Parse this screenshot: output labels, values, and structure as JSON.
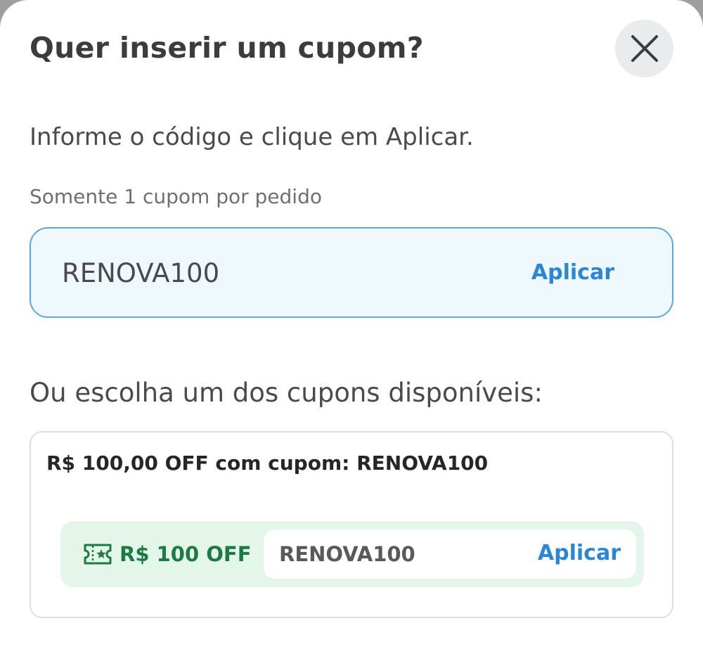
{
  "modal": {
    "title": "Quer inserir um cupom?",
    "close_icon": "close-icon",
    "instruction": "Informe o código e clique em Aplicar.",
    "hint": "Somente 1 cupom por pedido",
    "code_input": {
      "value": "RENOVA100",
      "apply_label": "Aplicar"
    },
    "available_title": "Ou escolha um dos cupons disponíveis:",
    "coupons": [
      {
        "description": "R$ 100,00 OFF com cupom: RENOVA100",
        "icon": "ticket-star-icon",
        "discount_label": "R$ 100 OFF",
        "code": "RENOVA100",
        "apply_label": "Aplicar"
      }
    ]
  },
  "colors": {
    "accent_blue": "#2b86d6",
    "discount_green": "#1c7a42",
    "discount_bg": "#e4f6ea",
    "input_bg": "#eef8fd",
    "input_border": "#5aa9d8"
  }
}
